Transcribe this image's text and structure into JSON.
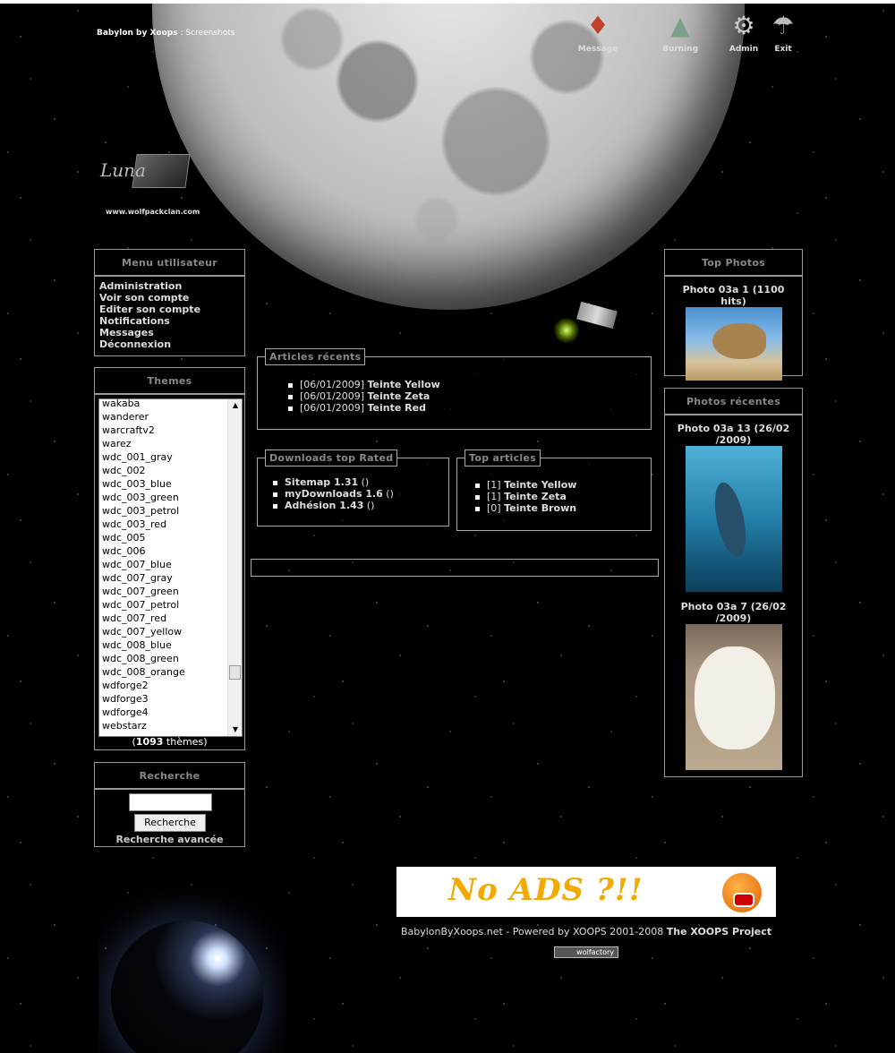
{
  "header": {
    "site_name": "Babylon by Xoops",
    "separator": " : ",
    "page": "Screenshots",
    "logo_text": "Luna",
    "logo_url": "www.wolfpackclan.com"
  },
  "top_nav": [
    {
      "label": "Message",
      "icon": "message-icon"
    },
    {
      "label": "Burning",
      "icon": "burning-icon"
    },
    {
      "label": "Admin",
      "icon": "admin-icon"
    },
    {
      "label": "Exit",
      "icon": "exit-icon"
    }
  ],
  "user_menu": {
    "title": "Menu utilisateur",
    "items": [
      "Administration",
      "Voir son compte",
      "Editer son compte",
      "Notifications",
      "Messages",
      "Déconnexion"
    ]
  },
  "themes": {
    "title": "Themes",
    "items": [
      "wakaba",
      "wanderer",
      "warcraftv2",
      "warez",
      "wdc_001_gray",
      "wdc_002",
      "wdc_003_blue",
      "wdc_003_green",
      "wdc_003_petrol",
      "wdc_003_red",
      "wdc_005",
      "wdc_006",
      "wdc_007_blue",
      "wdc_007_gray",
      "wdc_007_green",
      "wdc_007_petrol",
      "wdc_007_red",
      "wdc_007_yellow",
      "wdc_008_blue",
      "wdc_008_green",
      "wdc_008_orange",
      "wdforge2",
      "wdforge3",
      "wdforge4",
      "webstarz"
    ],
    "count": "1093",
    "count_suffix": " thèmes"
  },
  "search": {
    "title": "Recherche",
    "input_value": "",
    "button": "Recherche",
    "advanced": "Recherche avancée"
  },
  "articles_recent": {
    "title": "Articles récents",
    "items": [
      {
        "date": "[06/01/2009]",
        "title": "Teinte Yellow"
      },
      {
        "date": "[06/01/2009]",
        "title": "Teinte Zeta"
      },
      {
        "date": "[06/01/2009]",
        "title": "Teinte Red"
      }
    ]
  },
  "downloads": {
    "title": "Downloads top Rated",
    "items": [
      {
        "name": "Sitemap 1.31",
        "extra": " ()"
      },
      {
        "name": "myDownloads 1.6",
        "extra": " ()"
      },
      {
        "name": "Adhésion 1.43",
        "extra": " ()"
      }
    ]
  },
  "top_articles": {
    "title": "Top articles",
    "items": [
      {
        "count": "[1]",
        "title": "Teinte Yellow"
      },
      {
        "count": "[1]",
        "title": "Teinte Zeta"
      },
      {
        "count": "[0]",
        "title": "Teinte Brown"
      }
    ]
  },
  "top_photos": {
    "title": "Top Photos",
    "items": [
      {
        "caption": "Photo 03a 1 (1100 hits)"
      }
    ]
  },
  "recent_photos": {
    "title": "Photos récentes",
    "items": [
      {
        "caption": "Photo 03a 13 (26/02 /2009)"
      },
      {
        "caption": "Photo 03a 7 (26/02 /2009)"
      }
    ]
  },
  "ad": {
    "text": "No ADS ?!!"
  },
  "footer": {
    "text": "BabylonByXoops.net - Powered by XOOPS 2001-2008 ",
    "link": "The XOOPS Project",
    "badge": "wolfactory"
  }
}
